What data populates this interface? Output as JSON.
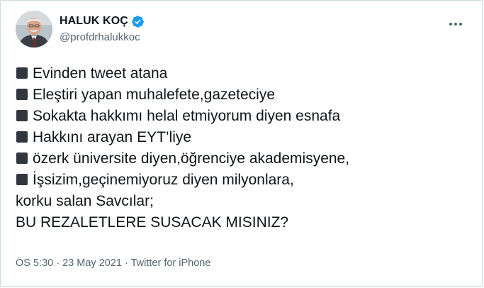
{
  "author": {
    "display_name": "HALUK KOÇ",
    "handle": "@profdrhalukkoc",
    "verified": true
  },
  "tweet": {
    "lines": [
      {
        "bullet": true,
        "text": "Evinden tweet atana"
      },
      {
        "bullet": true,
        "text": "Eleştiri yapan muhalefete,gazeteciye"
      },
      {
        "bullet": true,
        "text": "Sokakta hakkımı helal etmiyorum diyen esnafa"
      },
      {
        "bullet": true,
        "text": "Hakkını arayan EYT’liye"
      },
      {
        "bullet": true,
        "text": "özerk üniversite diyen,öğrenciye akademisyene,"
      },
      {
        "bullet": true,
        "text": "İşsizim,geçinemiyoruz diyen milyonlara,"
      },
      {
        "bullet": false,
        "text": "korku salan Savcılar;"
      },
      {
        "bullet": false,
        "text": "BU REZALETLERE SUSACAK MISINIZ?"
      }
    ]
  },
  "meta": {
    "time": "ÖS 5:30",
    "separator1": "·",
    "date": "23 May 2021",
    "separator2": "·",
    "source": "Twitter for iPhone"
  },
  "colors": {
    "text": "#0f1419",
    "secondary": "#536471",
    "verified": "#1d9bf0",
    "border": "#cfd9de"
  },
  "icons": {
    "verified": "verified-badge-icon",
    "more": "more-horizontal-icon",
    "bullet": "black-medium-square-icon"
  }
}
